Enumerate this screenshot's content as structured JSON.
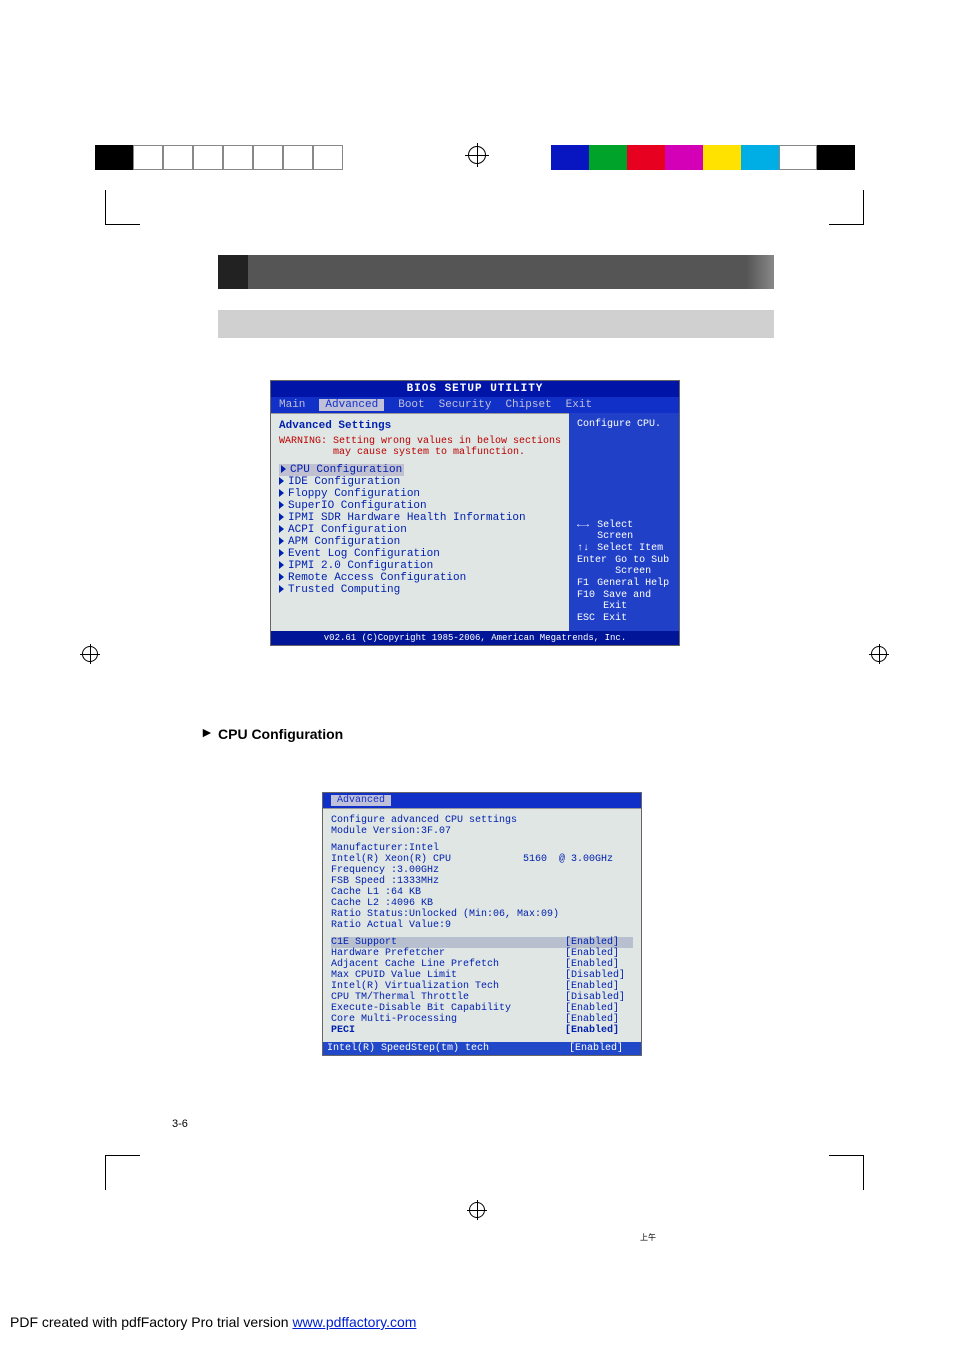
{
  "top_colors": [
    "#0816c1",
    "#00a32a",
    "#e7001f",
    "#d400b8",
    "#ffe200",
    "#00aee6",
    "#ffffff",
    "#000000"
  ],
  "advanced_title": "Advanced",
  "advanced_desc": "",
  "bios1": {
    "title": "BIOS SETUP UTILITY",
    "menu": [
      "Main",
      "Advanced",
      "Boot",
      "Security",
      "Chipset",
      "Exit"
    ],
    "menu_selected": "Advanced",
    "heading": "Advanced Settings",
    "warning": "WARNING: Setting wrong values in below sections\n         may cause system to malfunction.",
    "items": [
      "CPU Configuration",
      "IDE Configuration",
      "Floppy Configuration",
      "SuperIO Configuration",
      "IPMI SDR Hardware Health Information",
      "ACPI Configuration",
      "APM Configuration",
      "Event Log Configuration",
      "IPMI 2.0 Configuration",
      "Remote Access Configuration",
      "Trusted Computing"
    ],
    "right_title": "Configure CPU.",
    "keys": [
      [
        "←→",
        "Select Screen"
      ],
      [
        "↑↓",
        "Select Item"
      ],
      [
        "Enter",
        "Go to Sub Screen"
      ],
      [
        "F1",
        "General Help"
      ],
      [
        "F10",
        "Save and Exit"
      ],
      [
        "ESC",
        "Exit"
      ]
    ],
    "footer": "v02.61 (C)Copyright 1985-2006, American Megatrends, Inc."
  },
  "cpu_label": "CPU Configuration",
  "cpu_desc": "",
  "arrow": "►",
  "bios2": {
    "menu_selected": "Advanced",
    "heading": "Configure advanced CPU settings",
    "module": "Module Version:3F.07",
    "info": [
      "Manufacturer:Intel",
      "Intel(R) Xeon(R) CPU            5160  @ 3.00GHz",
      "Frequency   :3.00GHz",
      "FSB Speed   :1333MHz",
      "Cache L1    :64 KB",
      "Cache L2    :4096 KB",
      "Ratio Status:Unlocked (Min:06, Max:09)",
      "Ratio Actual Value:9"
    ],
    "hl_item": "C1E Support",
    "hl_val": "[Enabled]",
    "rows": [
      [
        "Hardware Prefetcher",
        "[Enabled]"
      ],
      [
        "Adjacent Cache Line Prefetch",
        "[Enabled]"
      ],
      [
        "Max CPUID Value Limit",
        "[Disabled]"
      ],
      [
        "Intel(R) Virtualization Tech",
        "[Enabled]"
      ],
      [
        "CPU TM/Thermal Throttle",
        "[Disabled]"
      ],
      [
        "Execute-Disable Bit Capability",
        "[Enabled]"
      ],
      [
        "Core Multi-Processing",
        "[Enabled]"
      ],
      [
        "PECI",
        "[Enabled]"
      ]
    ],
    "bottom_lab": "Intel(R) SpeedStep(tm) tech",
    "bottom_val": "[Enabled]"
  },
  "page_num": "3-6",
  "chinese": "上午",
  "pdf_footer_text": "PDF created with pdfFactory Pro trial version ",
  "pdf_footer_link": "www.pdffactory.com"
}
